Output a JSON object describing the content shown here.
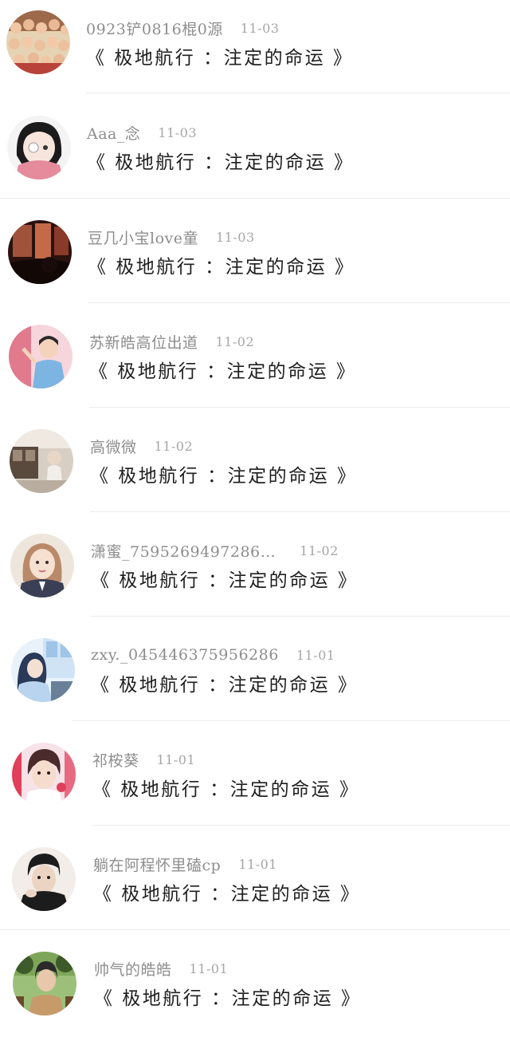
{
  "comments": [
    {
      "user": "0923铲0816棍0源",
      "date": "11-03",
      "text": "《 极地航行 ：注定的命运 》",
      "avatar_icon": "crowd-photo-avatar",
      "avatar_colors": [
        "#c7a37a",
        "#8c3b2a",
        "#e6d3b3"
      ]
    },
    {
      "user": "Aaa_念",
      "date": "11-03",
      "text": "《 极地航行 ：注定的命运 》",
      "avatar_icon": "anime-girl-avatar",
      "avatar_colors": [
        "#f1f1f1",
        "#1a1a1a",
        "#e58b9b"
      ]
    },
    {
      "user": "豆几小宝love童",
      "date": "11-03",
      "text": "《 极地航行 ：注定的命运 》",
      "avatar_icon": "dark-interior-avatar",
      "avatar_colors": [
        "#3a1a14",
        "#a0523a",
        "#1a0c0a"
      ]
    },
    {
      "user": "苏新皓高位出道",
      "date": "11-02",
      "text": "《 极地航行 ：注定的命运 》",
      "avatar_icon": "performer-avatar",
      "avatar_colors": [
        "#f2c2cc",
        "#7cb4e2",
        "#e07a8c"
      ]
    },
    {
      "user": "高微微",
      "date": "11-02",
      "text": "《 极地航行 ：注定的命运 》",
      "avatar_icon": "street-scene-avatar",
      "avatar_colors": [
        "#d8cfc4",
        "#5a4a3e",
        "#9b8a78"
      ]
    },
    {
      "user": "潇蜜_7595269497286…",
      "date": "11-02",
      "text": "《 极地航行 ：注定的命运 》",
      "avatar_icon": "uniform-portrait-avatar",
      "avatar_colors": [
        "#e8d4c2",
        "#3b3f55",
        "#b98a6a"
      ]
    },
    {
      "user": "zxy._045446375956286",
      "date": "11-01",
      "text": "《 极地航行 ：注定的命运 》",
      "avatar_icon": "window-girl-avatar",
      "avatar_colors": [
        "#cfe3f4",
        "#2a3a58",
        "#9ec4e8"
      ]
    },
    {
      "user": "祁桉葵",
      "date": "11-01",
      "text": "《 极地航行 ：注定的命运 》",
      "avatar_icon": "idol-portrait-avatar",
      "avatar_colors": [
        "#f3d3db",
        "#e0405a",
        "#4a2a2a"
      ]
    },
    {
      "user": "躺在阿程怀里磕cp",
      "date": "11-01",
      "text": "《 极地航行 ：注定的命运 》",
      "avatar_icon": "boy-portrait-avatar",
      "avatar_colors": [
        "#f2ede8",
        "#1c1c1c",
        "#d8c0ae"
      ]
    },
    {
      "user": "帅气的皓皓",
      "date": "11-01",
      "text": "《 极地航行 ：注定的命运 》",
      "avatar_icon": "outdoor-boy-avatar",
      "avatar_colors": [
        "#7ea65a",
        "#3c5a2a",
        "#c79a6a"
      ]
    }
  ]
}
